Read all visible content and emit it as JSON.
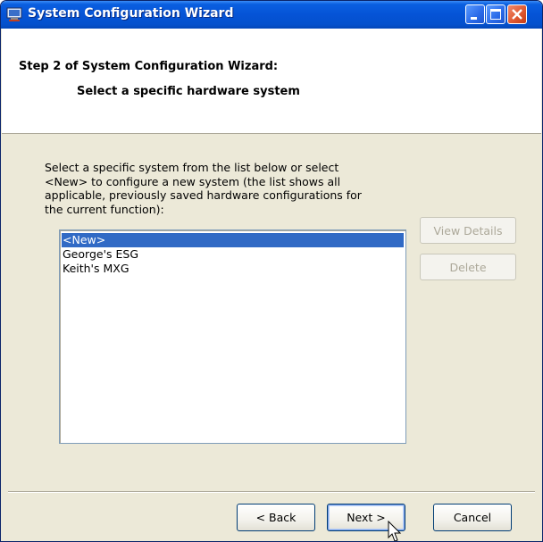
{
  "window": {
    "title": "System Configuration Wizard",
    "controls": {
      "minimize": "minimize-icon",
      "maximize": "maximize-icon",
      "close": "close-icon"
    }
  },
  "header": {
    "step_title": "Step 2 of System Configuration Wizard:",
    "step_subtitle": "Select a specific hardware system"
  },
  "instructions": [
    "Select a specific system from the list below or select",
    "<New> to configure a new system (the list shows all",
    "applicable, previously saved hardware configurations for",
    "the current function):"
  ],
  "systems_list": {
    "items": [
      "<New>",
      "George's ESG",
      "Keith's MXG"
    ],
    "selected": "<New>"
  },
  "side_buttons": {
    "view_details": "View Details",
    "delete": "Delete"
  },
  "footer": {
    "back": "< Back",
    "next": "Next >",
    "cancel": "Cancel"
  },
  "colors": {
    "titlebar": "#0553d6",
    "selection": "#316ac5",
    "dialog_bg": "#ece9d8"
  }
}
